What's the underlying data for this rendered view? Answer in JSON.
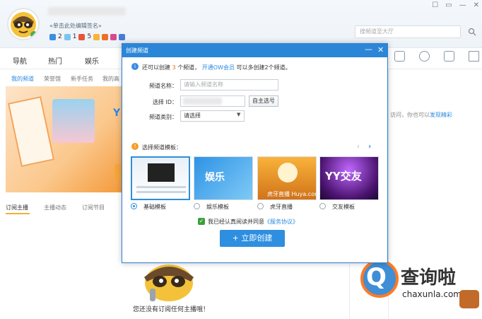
{
  "header": {
    "signature_hint": "«单击此处编辑签名»",
    "badge_counts": [
      "2",
      "1",
      "5"
    ],
    "window_controls": [
      "☐",
      "▭",
      "—",
      "✕"
    ],
    "search_placeholder": "搜频道至大厅"
  },
  "nav": {
    "items": [
      "导航",
      "热门",
      "娱乐"
    ],
    "sub_items": [
      "我的频道",
      "荣誉馆",
      "新手任务",
      "我的高"
    ]
  },
  "banner": {
    "logo_text": "Y"
  },
  "tabs": [
    "订阅主播",
    "主播动态",
    "订阅节目"
  ],
  "right_panel": {
    "text": "访问，你也可以",
    "link": "发现精彩"
  },
  "empty_state": {
    "text": "您还没有订阅任何主播哦！"
  },
  "watermark": {
    "q": "Q",
    "brand": "查询啦",
    "domain": "chaxunla.com"
  },
  "modal": {
    "title": "创建频道",
    "minimize": "—",
    "close": "✕",
    "info_icon": "i",
    "info_prefix": "还可以创建",
    "info_count": "3",
    "info_mid": "个频道，",
    "info_link": "开通OW会员",
    "info_suffix": "可以多创建2个频道。",
    "name_label": "频道名称：",
    "name_placeholder": "请输入频道名称",
    "id_label": "选择 ID：",
    "pick_button": "自主选号",
    "category_label": "频道类别：",
    "category_value": "请选择",
    "template_icon": "!",
    "template_title": "选择频道模板：",
    "prev": "‹",
    "next": "›",
    "templates": [
      {
        "label": "基础模板",
        "thumb_text": ""
      },
      {
        "label": "娱乐模板",
        "thumb_text": "娱乐"
      },
      {
        "label": "虎牙直播",
        "thumb_text": "虎牙直播 Huya.com"
      },
      {
        "label": "交友模板",
        "thumb_text": "YY交友"
      }
    ],
    "agree_prefix": "我已经认真阅读并同意",
    "agree_link": "《服务协议》",
    "create_button": "+ 立即创建"
  }
}
